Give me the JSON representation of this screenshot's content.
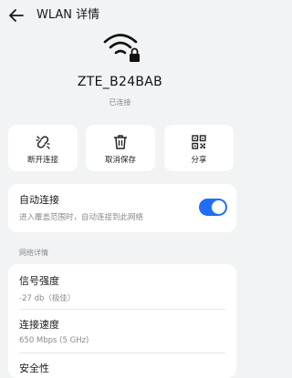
{
  "header": {
    "title": "WLAN 详情"
  },
  "network": {
    "ssid": "ZTE_B24BAB",
    "status": "已连接"
  },
  "actions": [
    {
      "label": "断开连接",
      "icon": "unlink-icon"
    },
    {
      "label": "取消保存",
      "icon": "trash-icon"
    },
    {
      "label": "分享",
      "icon": "qr-code-icon"
    }
  ],
  "auto_connect": {
    "title": "自动连接",
    "subtitle": "进入覆盖范围时，自动连接到此网络",
    "enabled": true
  },
  "section_title": "网络详情",
  "details": [
    {
      "label": "信号强度",
      "value": "-27 db（极佳）"
    },
    {
      "label": "连接速度",
      "value": "650 Mbps (5 GHz)"
    },
    {
      "label": "安全性",
      "value": ""
    }
  ],
  "colors": {
    "accent": "#1f6ff5",
    "background": "#f1f3f5"
  }
}
